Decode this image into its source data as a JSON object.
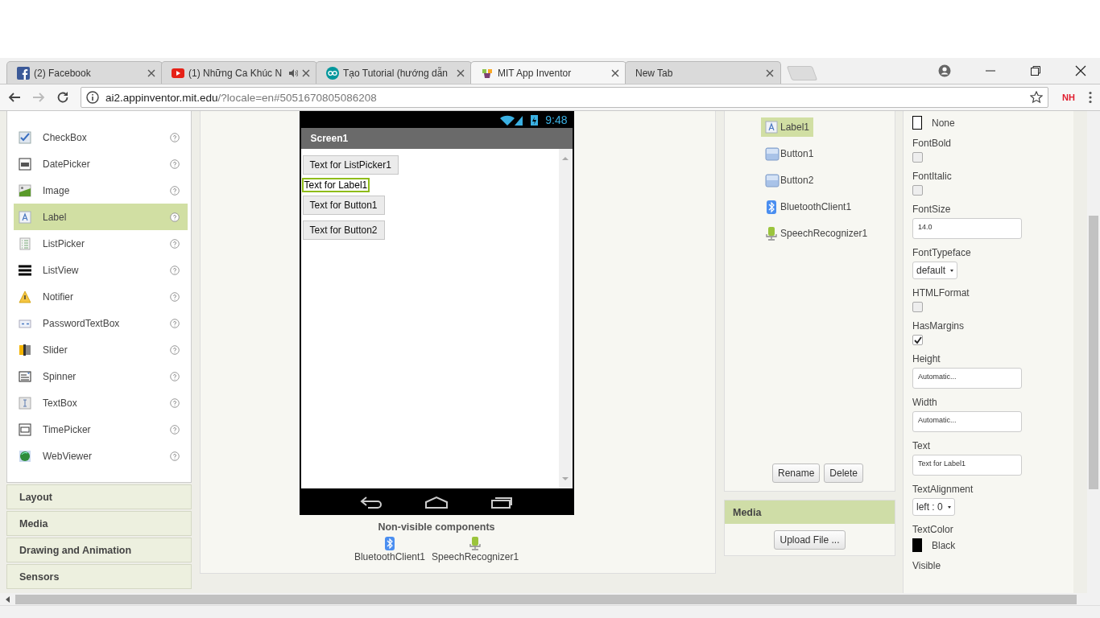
{
  "browser": {
    "tabs": [
      {
        "title": "(2) Facebook",
        "kind": "facebook",
        "selected": false,
        "audio": false
      },
      {
        "title": "(1) Những Ca Khúc N",
        "kind": "youtube",
        "selected": false,
        "audio": true
      },
      {
        "title": "Tạo Tutorial (hướng dẫn",
        "kind": "arduino",
        "selected": false,
        "audio": false
      },
      {
        "title": "MIT App Inventor",
        "kind": "appinventor",
        "selected": true,
        "audio": false
      },
      {
        "title": "New Tab",
        "selected": false,
        "audio": false
      }
    ],
    "address": {
      "host": "ai2.appinventor.mit.edu",
      "path": "/?locale=en#5051670805086208"
    },
    "extension": "NH"
  },
  "palette": {
    "items": [
      {
        "label": "CheckBox",
        "kind": "checkbox",
        "selected": false
      },
      {
        "label": "DatePicker",
        "kind": "datepicker",
        "selected": false
      },
      {
        "label": "Image",
        "kind": "image",
        "selected": false
      },
      {
        "label": "Label",
        "kind": "label",
        "selected": true
      },
      {
        "label": "ListPicker",
        "kind": "listpicker",
        "selected": false
      },
      {
        "label": "ListView",
        "kind": "listview",
        "selected": false
      },
      {
        "label": "Notifier",
        "kind": "notifier",
        "selected": false
      },
      {
        "label": "PasswordTextBox",
        "kind": "password",
        "selected": false
      },
      {
        "label": "Slider",
        "kind": "slider",
        "selected": false
      },
      {
        "label": "Spinner",
        "kind": "spinner",
        "selected": false
      },
      {
        "label": "TextBox",
        "kind": "textbox",
        "selected": false
      },
      {
        "label": "TimePicker",
        "kind": "timepicker",
        "selected": false
      },
      {
        "label": "WebViewer",
        "kind": "webviewer",
        "selected": false
      }
    ],
    "sections": [
      {
        "label": "Layout"
      },
      {
        "label": "Media"
      },
      {
        "label": "Drawing and Animation"
      },
      {
        "label": "Sensors"
      }
    ]
  },
  "viewer": {
    "time": "9:48",
    "screen_title": "Screen1",
    "components": [
      {
        "kind": "button",
        "text": "Text for ListPicker1",
        "selected": false
      },
      {
        "kind": "label",
        "text": "Text for Label1",
        "selected": true
      },
      {
        "kind": "button",
        "text": "Text for Button1",
        "selected": false
      },
      {
        "kind": "button",
        "text": "Text for Button2",
        "selected": false
      }
    ],
    "nonvisible_title": "Non-visible components",
    "nonvisible": [
      {
        "label": "BluetoothClient1",
        "kind": "bluetooth"
      },
      {
        "label": "SpeechRecognizer1",
        "kind": "speech"
      }
    ]
  },
  "components": {
    "items": [
      {
        "label": "Label1",
        "kind": "label",
        "selected": true
      },
      {
        "label": "Button1",
        "kind": "button",
        "selected": false
      },
      {
        "label": "Button2",
        "kind": "button",
        "selected": false
      },
      {
        "label": "BluetoothClient1",
        "kind": "bluetooth",
        "selected": false
      },
      {
        "label": "SpeechRecognizer1",
        "kind": "speech",
        "selected": false
      }
    ],
    "buttons": [
      "Rename",
      "Delete"
    ]
  },
  "media": {
    "title": "Media",
    "button": "Upload File ..."
  },
  "properties": [
    {
      "kind": "color",
      "value": "None",
      "color": "#ffffff"
    },
    {
      "kind": "checkbox",
      "label": "FontBold",
      "checked": false
    },
    {
      "kind": "checkbox",
      "label": "FontItalic",
      "checked": false
    },
    {
      "kind": "text",
      "label": "FontSize",
      "value": "14.0"
    },
    {
      "kind": "dropdown",
      "label": "FontTypeface",
      "value": "default"
    },
    {
      "kind": "checkbox",
      "label": "HTMLFormat",
      "checked": false
    },
    {
      "kind": "checkbox",
      "label": "HasMargins",
      "checked": true
    },
    {
      "kind": "text",
      "label": "Height",
      "value": "Automatic..."
    },
    {
      "kind": "text",
      "label": "Width",
      "value": "Automatic..."
    },
    {
      "kind": "text",
      "label": "Text",
      "value": "Text for Label1"
    },
    {
      "kind": "dropdown",
      "label": "TextAlignment",
      "value": "left : 0"
    },
    {
      "kind": "color",
      "label": "TextColor",
      "value": "Black",
      "color": "#000000"
    },
    {
      "kind": "label",
      "label": "Visible"
    }
  ]
}
